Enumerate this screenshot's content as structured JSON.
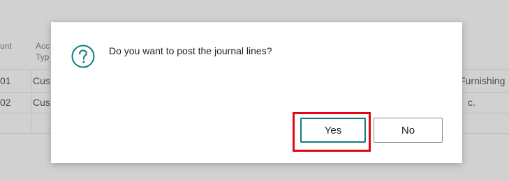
{
  "background": {
    "col_amount_header": "unt",
    "col_account_type_header_1": "Acc",
    "col_account_type_header_2": "Typ",
    "rows": [
      {
        "num": "01",
        "type": "Cus",
        "name": "Furnishing"
      },
      {
        "num": "02",
        "type": "Cus",
        "name": "c."
      }
    ]
  },
  "dialog": {
    "icon": "question-circle-icon",
    "message": "Do you want to post the journal lines?",
    "yes_label": "Yes",
    "no_label": "No",
    "accent_color": "#0f7b83",
    "highlight_color": "#e30613"
  }
}
